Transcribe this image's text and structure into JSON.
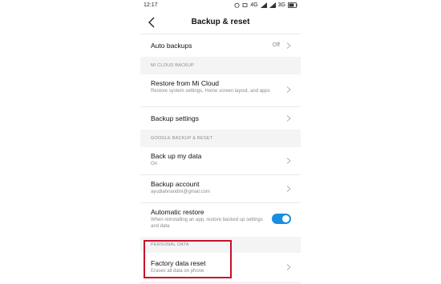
{
  "status": {
    "time": "12:17",
    "network_4g": "4G",
    "network_3g": "3G"
  },
  "header": {
    "title": "Backup & reset"
  },
  "auto_backups": {
    "label": "Auto backups",
    "value": "Off"
  },
  "mi_cloud": {
    "section_title": "MI CLOUD BACKUP",
    "restore": {
      "label": "Restore from Mi Cloud",
      "sub": "Restore system settings, Home screen layout, and apps"
    },
    "backup_settings": {
      "label": "Backup settings"
    }
  },
  "google": {
    "section_title": "GOOGLE BACKUP & RESET",
    "back_up_data": {
      "label": "Back up my data",
      "sub": "On"
    },
    "backup_account": {
      "label": "Backup account",
      "sub": "ayudiahnandini@gmail.com"
    },
    "automatic_restore": {
      "label": "Automatic restore",
      "sub": "When reinstalling an app, restore backed up settings and data",
      "enabled": true
    }
  },
  "personal": {
    "section_title": "PERSONAL DATA",
    "factory_reset": {
      "label": "Factory data reset",
      "sub": "Erases all data on phone"
    }
  },
  "colors": {
    "accent": "#1a8de0",
    "highlight": "#c8102e"
  }
}
